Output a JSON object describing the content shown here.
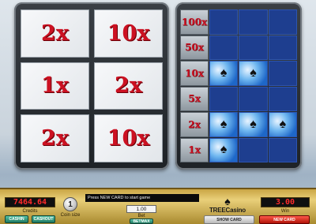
{
  "multipliers": [
    "2x",
    "10x",
    "1x",
    "2x",
    "2x",
    "10x"
  ],
  "pay_table": [
    {
      "label": "100x",
      "cards": 0
    },
    {
      "label": "50x",
      "cards": 0
    },
    {
      "label": "10x",
      "cards": 2
    },
    {
      "label": "5x",
      "cards": 0
    },
    {
      "label": "2x",
      "cards": 3
    },
    {
      "label": "1x",
      "cards": 1
    }
  ],
  "card_suit_icon": "spade-icon",
  "colors": {
    "multiplier_text": "#cc1122",
    "pay_slot_blue": "#1e3e8f",
    "display_red": "#ff2b2b"
  },
  "credits": {
    "value": "7464.64",
    "label": "Credits"
  },
  "coin": {
    "value": "1",
    "label": "Coin size"
  },
  "message": "Press NEW CARD to start game",
  "bet": {
    "value": "1.00",
    "label": "Bet"
  },
  "win": {
    "value": "3.00",
    "label": "Win"
  },
  "buttons": {
    "cashin": "CASHIN",
    "cashout": "CASHOUT",
    "betmax": "BETMAX",
    "show_card": "SHOW CARD",
    "new_card": "NEW CARD"
  },
  "logo": {
    "text": "TREECasino"
  }
}
